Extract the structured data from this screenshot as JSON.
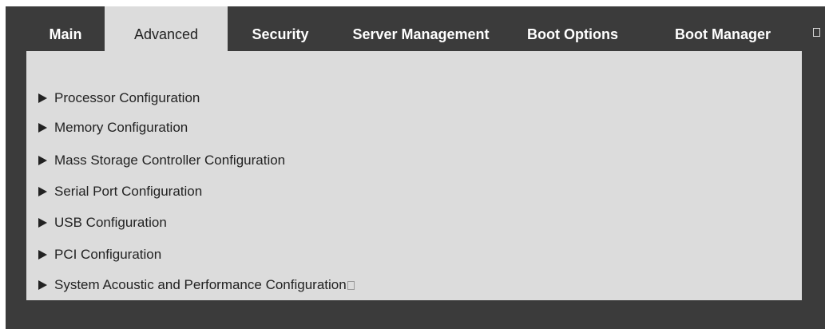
{
  "tabs": [
    {
      "label": "Main",
      "active": false
    },
    {
      "label": "Advanced",
      "active": true
    },
    {
      "label": "Security",
      "active": false
    },
    {
      "label": "Server Management",
      "active": false
    },
    {
      "label": "Boot Options",
      "active": false
    },
    {
      "label": "Boot Manager",
      "active": false
    }
  ],
  "icons": {
    "tab_overflow": "box-icon",
    "submenu": "triangle-right-icon"
  },
  "menu": [
    {
      "label": "Processor Configuration"
    },
    {
      "label": "Memory Configuration"
    },
    {
      "label": "Mass Storage Controller Configuration"
    },
    {
      "label": "Serial Port Configuration"
    },
    {
      "label": "USB Configuration"
    },
    {
      "label": "PCI Configuration"
    },
    {
      "label": "System Acoustic and Performance Configuration"
    }
  ],
  "colors": {
    "background": "#3b3b3b",
    "panel": "#dcdcdc",
    "tab_text": "#ffffff",
    "active_tab_text": "#222222"
  }
}
